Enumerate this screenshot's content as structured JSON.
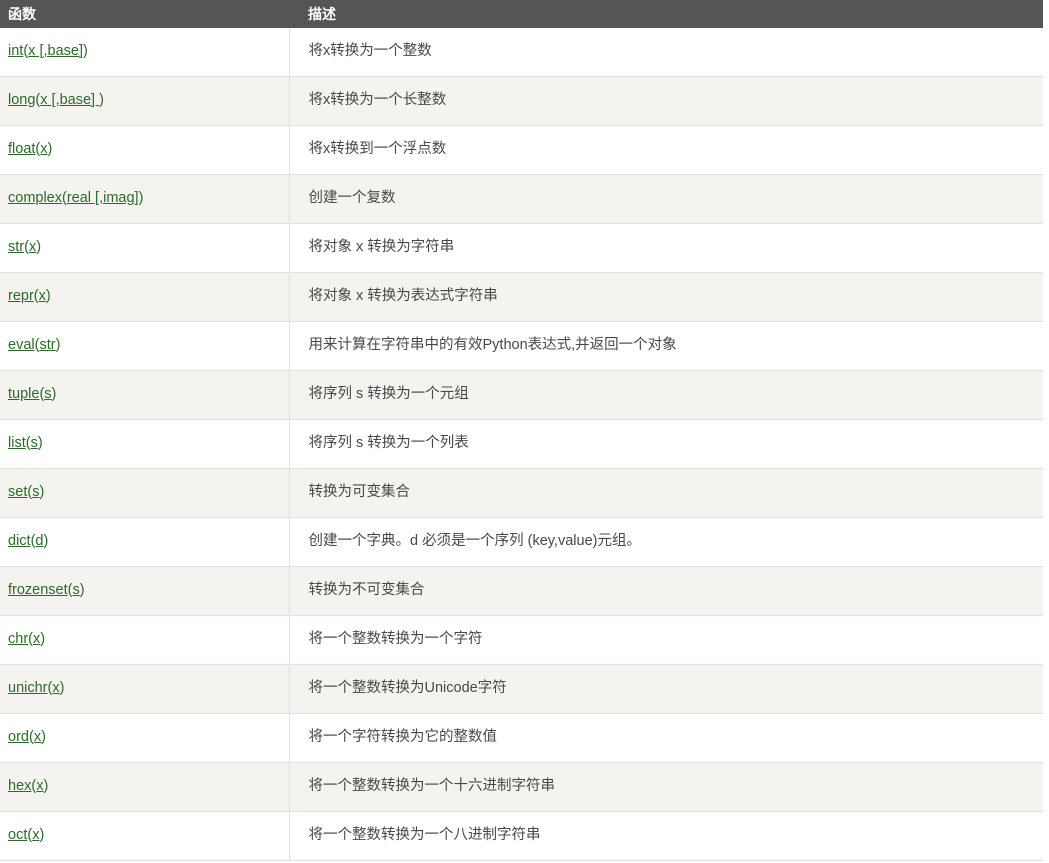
{
  "table": {
    "columns": [
      {
        "key": "function",
        "label": "函数"
      },
      {
        "key": "description",
        "label": "描述"
      }
    ],
    "rows": [
      {
        "function": "int(x [,base])",
        "fn_parts": [
          {
            "t": "int",
            "u": true
          },
          {
            "t": "(",
            "u": false
          },
          {
            "t": "x [,base]",
            "u": true
          },
          {
            "t": ")",
            "u": false
          }
        ],
        "description": "将x转换为一个整数"
      },
      {
        "function": "long(x [,base] )",
        "fn_parts": [
          {
            "t": "long",
            "u": true
          },
          {
            "t": "(",
            "u": false
          },
          {
            "t": "x [,base] ",
            "u": true
          },
          {
            "t": ")",
            "u": false
          }
        ],
        "description": "将x转换为一个长整数"
      },
      {
        "function": "float(x)",
        "fn_parts": [
          {
            "t": "float",
            "u": true
          },
          {
            "t": "(",
            "u": false
          },
          {
            "t": "x",
            "u": true
          },
          {
            "t": ")",
            "u": false
          }
        ],
        "description": "将x转换到一个浮点数"
      },
      {
        "function": "complex(real [,imag])",
        "fn_parts": [
          {
            "t": "complex",
            "u": true
          },
          {
            "t": "(",
            "u": false
          },
          {
            "t": "real [,imag]",
            "u": true
          },
          {
            "t": ")",
            "u": false
          }
        ],
        "description": "创建一个复数"
      },
      {
        "function": "str(x)",
        "fn_parts": [
          {
            "t": "str",
            "u": true
          },
          {
            "t": "(",
            "u": false
          },
          {
            "t": "x",
            "u": true
          },
          {
            "t": ")",
            "u": false
          }
        ],
        "description": "将对象 x 转换为字符串"
      },
      {
        "function": "repr(x)",
        "fn_parts": [
          {
            "t": "repr",
            "u": true
          },
          {
            "t": "(",
            "u": false
          },
          {
            "t": "x",
            "u": true
          },
          {
            "t": ")",
            "u": false
          }
        ],
        "description": "将对象 x 转换为表达式字符串"
      },
      {
        "function": "eval(str)",
        "fn_parts": [
          {
            "t": "eval",
            "u": true
          },
          {
            "t": "(",
            "u": false
          },
          {
            "t": "str",
            "u": true
          },
          {
            "t": ")",
            "u": false
          }
        ],
        "description": "用来计算在字符串中的有效Python表达式,并返回一个对象"
      },
      {
        "function": "tuple(s)",
        "fn_parts": [
          {
            "t": "tuple",
            "u": true
          },
          {
            "t": "(",
            "u": false
          },
          {
            "t": "s",
            "u": true
          },
          {
            "t": ")",
            "u": false
          }
        ],
        "description": "将序列 s 转换为一个元组"
      },
      {
        "function": "list(s)",
        "fn_parts": [
          {
            "t": "list",
            "u": true
          },
          {
            "t": "(",
            "u": false
          },
          {
            "t": "s",
            "u": true
          },
          {
            "t": ")",
            "u": false
          }
        ],
        "description": "将序列 s 转换为一个列表"
      },
      {
        "function": "set(s)",
        "fn_parts": [
          {
            "t": "set",
            "u": true
          },
          {
            "t": "(",
            "u": false
          },
          {
            "t": "s",
            "u": true
          },
          {
            "t": ")",
            "u": false
          }
        ],
        "description": "转换为可变集合"
      },
      {
        "function": "dict(d)",
        "fn_parts": [
          {
            "t": "dict",
            "u": true
          },
          {
            "t": "(",
            "u": false
          },
          {
            "t": "d",
            "u": true
          },
          {
            "t": ")",
            "u": false
          }
        ],
        "description": "创建一个字典。d 必须是一个序列 (key,value)元组。"
      },
      {
        "function": "frozenset(s)",
        "fn_parts": [
          {
            "t": "frozenset",
            "u": true
          },
          {
            "t": "(",
            "u": false
          },
          {
            "t": "s",
            "u": true
          },
          {
            "t": ")",
            "u": false
          }
        ],
        "description": "转换为不可变集合"
      },
      {
        "function": "chr(x)",
        "fn_parts": [
          {
            "t": "chr",
            "u": true
          },
          {
            "t": "(",
            "u": false
          },
          {
            "t": "x",
            "u": true
          },
          {
            "t": ")",
            "u": false
          }
        ],
        "description": "将一个整数转换为一个字符"
      },
      {
        "function": "unichr(x)",
        "fn_parts": [
          {
            "t": "unichr",
            "u": true
          },
          {
            "t": "(",
            "u": false
          },
          {
            "t": "x",
            "u": true
          },
          {
            "t": ")",
            "u": false
          }
        ],
        "description": "将一个整数转换为Unicode字符"
      },
      {
        "function": "ord(x)",
        "fn_parts": [
          {
            "t": "ord",
            "u": true
          },
          {
            "t": "(",
            "u": false
          },
          {
            "t": "x",
            "u": true
          },
          {
            "t": ")",
            "u": false
          }
        ],
        "description": "将一个字符转换为它的整数值"
      },
      {
        "function": "hex(x)",
        "fn_parts": [
          {
            "t": "hex",
            "u": true
          },
          {
            "t": "(",
            "u": false
          },
          {
            "t": "x",
            "u": true
          },
          {
            "t": ")",
            "u": false
          }
        ],
        "description": "将一个整数转换为一个十六进制字符串"
      },
      {
        "function": "oct(x)",
        "fn_parts": [
          {
            "t": "oct",
            "u": true
          },
          {
            "t": "(",
            "u": false
          },
          {
            "t": "x",
            "u": true
          },
          {
            "t": ")",
            "u": false
          }
        ],
        "description": "将一个整数转换为一个八进制字符串"
      }
    ]
  },
  "colors": {
    "header_bg": "#555555",
    "header_fg": "#ffffff",
    "link": "#2a6b2a",
    "row_odd_bg": "#ffffff",
    "row_even_bg": "#f4f3ef",
    "border": "#e2e2dd",
    "text": "#4a4a4a"
  }
}
